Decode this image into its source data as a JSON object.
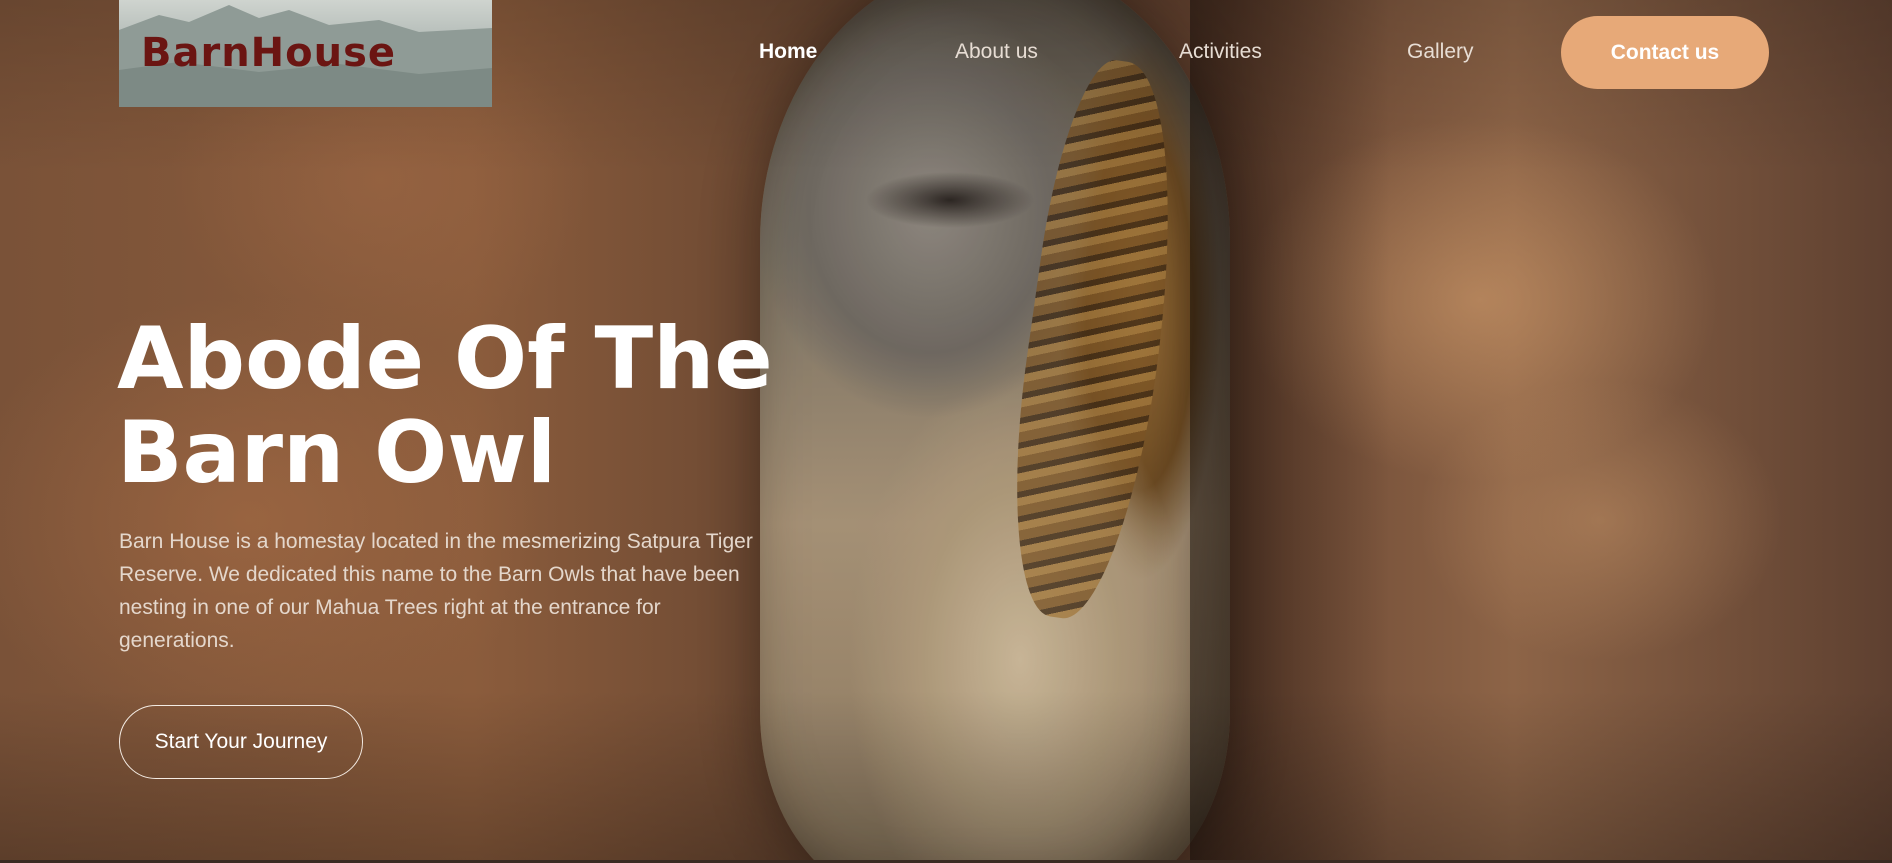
{
  "header": {
    "logo_text": "BarnHouse",
    "nav": [
      {
        "label": "Home",
        "active": true
      },
      {
        "label": "About us",
        "active": false
      },
      {
        "label": "Activities",
        "active": false
      },
      {
        "label": "Gallery",
        "active": false
      }
    ],
    "contact_label": "Contact us"
  },
  "hero": {
    "title_line1": "Abode Of The",
    "title_line2": "Barn Owl",
    "description": "Barn House is a homestay located in the mesmerizing Satpura Tiger Reserve. We dedicated this name to the Barn Owls that have been nesting in one of our Mahua Trees right at the entrance for generations.",
    "cta_label": "Start Your Journey"
  },
  "colors": {
    "accent": "#e7a978",
    "logo_text": "#6b1512",
    "text_primary": "#ffffff"
  }
}
